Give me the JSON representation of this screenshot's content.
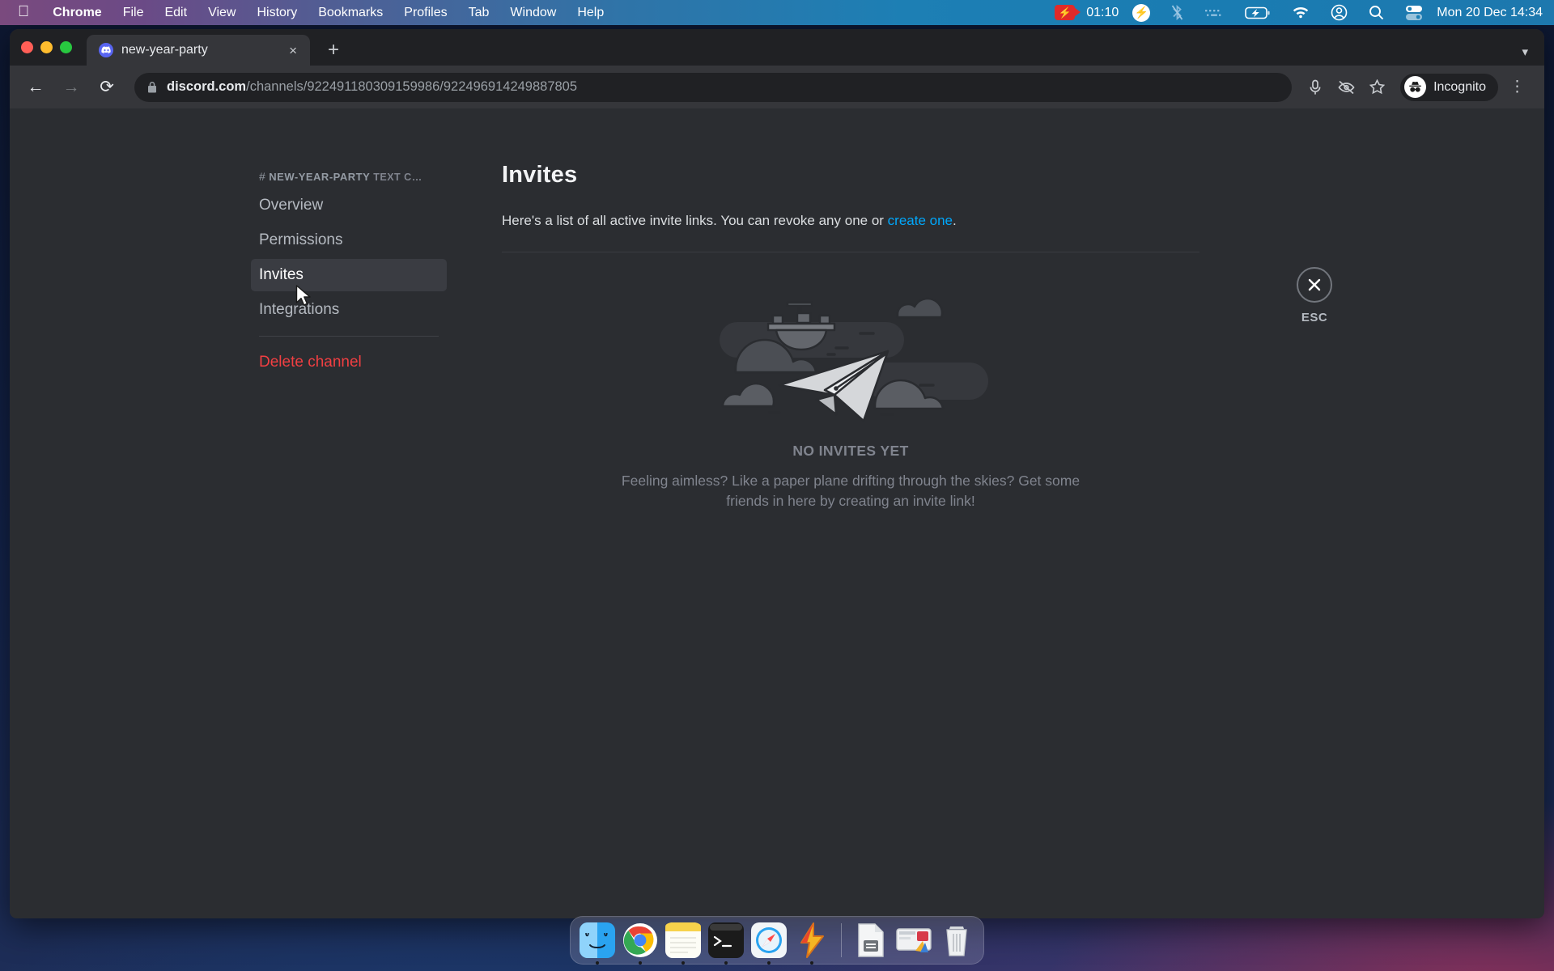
{
  "menubar": {
    "apple_icon": "apple-logo-icon",
    "items": [
      {
        "label": "Chrome",
        "bold": true
      },
      {
        "label": "File",
        "bold": false
      },
      {
        "label": "Edit",
        "bold": false
      },
      {
        "label": "View",
        "bold": false
      },
      {
        "label": "History",
        "bold": false
      },
      {
        "label": "Bookmarks",
        "bold": false
      },
      {
        "label": "Profiles",
        "bold": false
      },
      {
        "label": "Tab",
        "bold": false
      },
      {
        "label": "Window",
        "bold": false
      },
      {
        "label": "Help",
        "bold": false
      }
    ],
    "screen_recording_time": "01:10",
    "tray_icons": [
      "screen-record-icon",
      "flash-circle-icon",
      "bluetooth-off-icon",
      "keyboard-icon",
      "battery-charging-icon",
      "wifi-icon",
      "control-center-user-icon",
      "search-icon",
      "display-toggle-icon"
    ],
    "clock": "Mon 20 Dec  14:34"
  },
  "browser": {
    "tab": {
      "title": "new-year-party",
      "favicon": "discord-icon",
      "close_label": "×"
    },
    "new_tab_label": "+",
    "tab_list_chevron": "chevron-down-icon",
    "toolbar": {
      "back": "←",
      "forward": "→",
      "reload": "⟳",
      "lock_icon": "lock-icon",
      "url_host": "discord.com",
      "url_path": "/channels/922491180309159986/922496914249887805",
      "mic_icon": "microphone-icon",
      "hidden_icon": "eye-slash-icon",
      "bookmark_icon": "star-icon",
      "profile_label": "Incognito",
      "menu_icon": "kebab-menu-icon"
    }
  },
  "settings": {
    "sidebar": {
      "channel_hash": "#",
      "channel_name": "NEW-YEAR-PARTY",
      "channel_type": "TEXT C…",
      "items": [
        {
          "label": "Overview",
          "active": false
        },
        {
          "label": "Permissions",
          "active": false
        },
        {
          "label": "Invites",
          "active": true
        },
        {
          "label": "Integrations",
          "active": false
        }
      ],
      "delete_label": "Delete channel"
    },
    "main": {
      "title": "Invites",
      "description_before": "Here's a list of all active invite links. You can revoke any one or ",
      "description_link": "create one",
      "description_after": ".",
      "empty_title": "NO INVITES YET",
      "empty_subtitle": "Feeling aimless? Like a paper plane drifting through the skies? Get some friends in here by creating an invite link!",
      "illustration": "paper-plane-clouds-illustration"
    },
    "close": {
      "icon": "close-x-icon",
      "label": "ESC"
    }
  },
  "dock": {
    "items": [
      {
        "name": "finder",
        "running": true
      },
      {
        "name": "chrome",
        "running": true
      },
      {
        "name": "stickies",
        "running": true
      },
      {
        "name": "terminal",
        "running": true
      },
      {
        "name": "safari",
        "running": true
      },
      {
        "name": "flash-app",
        "running": true
      },
      {
        "name": "document-file",
        "running": false
      },
      {
        "name": "screenshot-image",
        "running": false
      },
      {
        "name": "trash",
        "running": false
      }
    ]
  },
  "colors": {
    "discord_blurple": "#5865f2",
    "link_blue": "#00a8fc",
    "danger_red": "#f23f42",
    "sidebar_bg": "#2b2d31",
    "main_bg": "#313338"
  }
}
